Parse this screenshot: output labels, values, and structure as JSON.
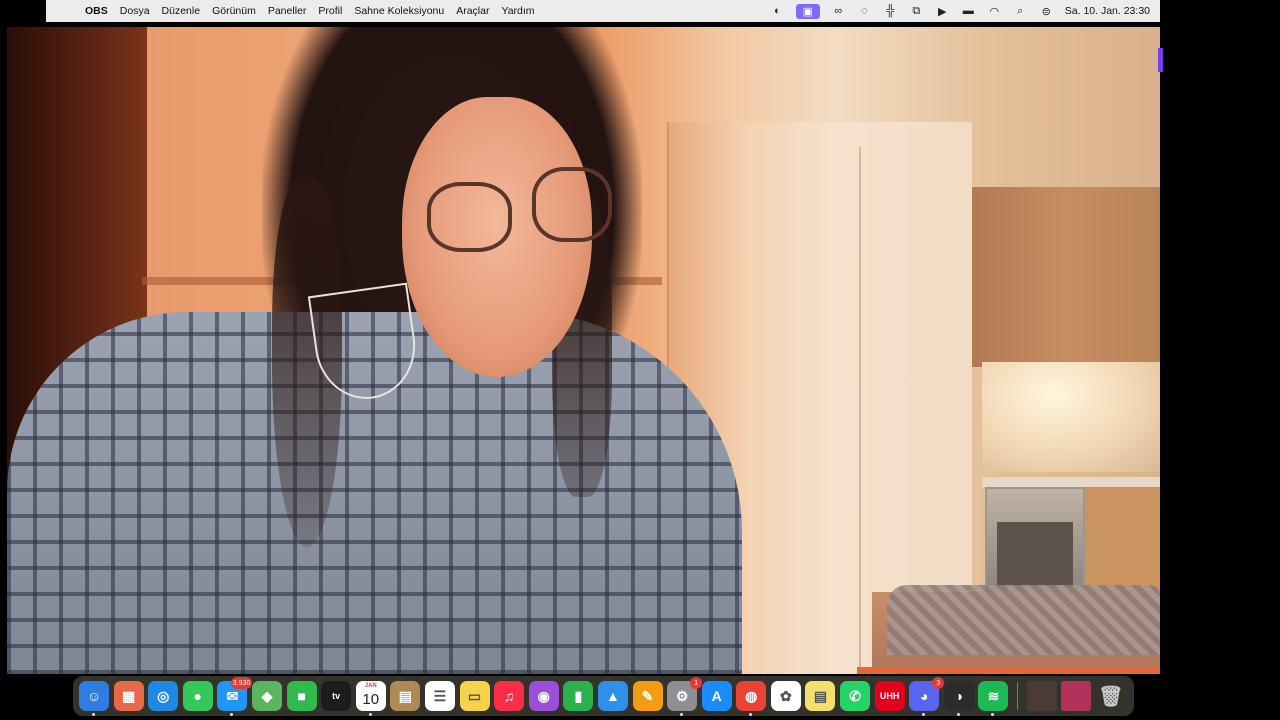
{
  "menubar": {
    "app_name": "OBS",
    "items": [
      "Dosya",
      "Düzenle",
      "Görünüm",
      "Paneller",
      "Profil",
      "Sahne Koleksiyonu",
      "Araçlar",
      "Yardım"
    ],
    "clock": "Sa. 10. Jan.  23:30",
    "status_icons": [
      "screen-share-icon",
      "obs-icon",
      "creative-cloud-icon",
      "wifi-extra-icon",
      "airpods-icon",
      "window-icon",
      "play-icon",
      "battery-icon",
      "wifi-icon",
      "search-icon",
      "control-center-icon"
    ]
  },
  "dock": {
    "apps": [
      {
        "name": "Finder",
        "icon": "finder-icon",
        "color": "#2f7de1",
        "glyph": "☺",
        "running": true
      },
      {
        "name": "Launchpad",
        "icon": "launchpad-icon",
        "color": "#e8684a",
        "glyph": "▦",
        "running": false
      },
      {
        "name": "Safari",
        "icon": "safari-icon",
        "color": "#1e88e5",
        "glyph": "◎",
        "running": false
      },
      {
        "name": "Messages",
        "icon": "messages-icon",
        "color": "#34c759",
        "glyph": "●",
        "running": false
      },
      {
        "name": "Mail",
        "icon": "mail-icon",
        "color": "#2196f3",
        "glyph": "✉",
        "running": true,
        "badge": "3.936"
      },
      {
        "name": "Maps",
        "icon": "maps-icon",
        "color": "#5ab55e",
        "glyph": "◆",
        "running": false
      },
      {
        "name": "FaceTime",
        "icon": "facetime-icon",
        "color": "#30b94d",
        "glyph": "■",
        "running": false
      },
      {
        "name": "Apple TV",
        "icon": "apple-tv-icon",
        "color": "#1c1c1c",
        "glyph": "tv",
        "running": false
      },
      {
        "name": "Calendar",
        "icon": "calendar-icon",
        "color": "#ffffff",
        "month": "JAN",
        "day": "10",
        "running": true
      },
      {
        "name": "Notes Wooden",
        "icon": "brown-app-icon",
        "color": "#b08a55",
        "glyph": "▤",
        "running": false
      },
      {
        "name": "Reminders",
        "icon": "reminders-icon",
        "color": "#ffffff",
        "glyph": "☰",
        "running": false
      },
      {
        "name": "Notes",
        "icon": "notes-icon",
        "color": "#f7d34b",
        "glyph": "▭",
        "running": false
      },
      {
        "name": "Music",
        "icon": "music-icon",
        "color": "#fa2d48",
        "glyph": "♫",
        "running": false
      },
      {
        "name": "Podcasts",
        "icon": "podcasts-icon",
        "color": "#9b4fd8",
        "glyph": "◉",
        "running": false
      },
      {
        "name": "Numbers",
        "icon": "numbers-icon",
        "color": "#2bb24c",
        "glyph": "▮",
        "running": false
      },
      {
        "name": "Keynote",
        "icon": "keynote-icon",
        "color": "#2e90e8",
        "glyph": "▲",
        "running": false
      },
      {
        "name": "Pages",
        "icon": "pages-icon",
        "color": "#f39c12",
        "glyph": "✎",
        "running": false
      },
      {
        "name": "System Settings",
        "icon": "settings-icon",
        "color": "#8e8e93",
        "glyph": "⚙",
        "running": true,
        "badge": "1"
      },
      {
        "name": "App Store",
        "icon": "app-store-icon",
        "color": "#1a8cff",
        "glyph": "A",
        "running": false
      },
      {
        "name": "Chrome",
        "icon": "chrome-icon",
        "color": "#ea4335",
        "glyph": "◍",
        "running": true
      },
      {
        "name": "ChatGPT",
        "icon": "chatgpt-icon",
        "color": "#ffffff",
        "glyph": "✿",
        "running": false
      },
      {
        "name": "Stickies",
        "icon": "stickies-icon",
        "color": "#f3df6b",
        "glyph": "▤",
        "running": false
      },
      {
        "name": "WhatsApp",
        "icon": "whatsapp-icon",
        "color": "#25d366",
        "glyph": "✆",
        "running": false
      },
      {
        "name": "UHH",
        "icon": "uhh-icon",
        "color": "#e2001a",
        "glyph": "UHH",
        "running": false
      },
      {
        "name": "Discord",
        "icon": "discord-icon",
        "color": "#5865f2",
        "glyph": "◕",
        "running": true,
        "badge": "3"
      },
      {
        "name": "OBS",
        "icon": "obs-app-icon",
        "color": "#2b2b2b",
        "glyph": "◑",
        "running": true
      },
      {
        "name": "Spotify",
        "icon": "spotify-icon",
        "color": "#1db954",
        "glyph": "≋",
        "running": true
      }
    ],
    "recent": [
      {
        "name": "Recent window 1",
        "icon": "window-thumbnail-icon",
        "color": "#4a3b35"
      },
      {
        "name": "Recent window 2",
        "icon": "window-thumbnail-icon",
        "color": "#b0315a"
      }
    ],
    "trash": {
      "name": "Trash",
      "icon": "trash-icon",
      "color": "#c8c8c8",
      "glyph": "🗑"
    }
  }
}
